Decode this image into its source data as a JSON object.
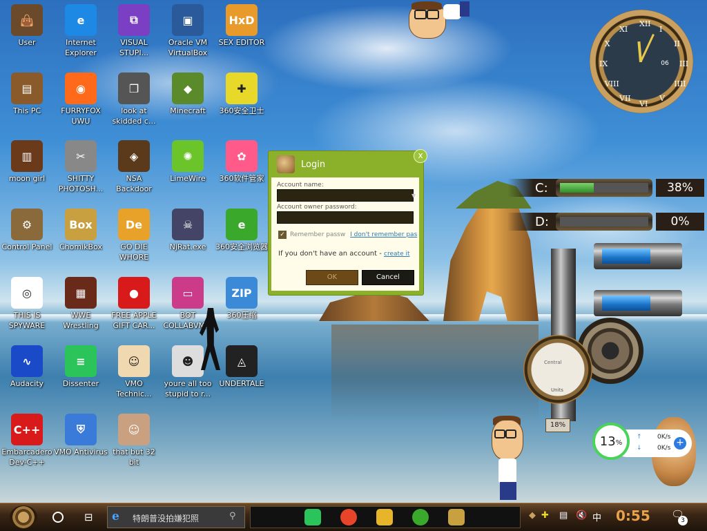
{
  "desktop": {
    "icons": [
      {
        "label": "User",
        "color": "#6a4a2a",
        "glyph": "👜"
      },
      {
        "label": "Internet Explorer",
        "color": "#1e88e5",
        "glyph": "e"
      },
      {
        "label": "VISUAL STUPI...",
        "color": "#7b3fc4",
        "glyph": "⧉"
      },
      {
        "label": "Oracle VM VirtualBox",
        "color": "#2a5a9a",
        "glyph": "▣"
      },
      {
        "label": "SEX EDITOR",
        "color": "#e89a2a",
        "glyph": "HxD"
      },
      {
        "label": "This PC",
        "color": "#8a5a2a",
        "glyph": "▤"
      },
      {
        "label": "FURRYFOX UWU",
        "color": "#ff6a1a",
        "glyph": "◉"
      },
      {
        "label": "look at skidded c...",
        "color": "#555555",
        "glyph": "❐"
      },
      {
        "label": "Minecraft",
        "color": "#5a8a2a",
        "glyph": "◆"
      },
      {
        "label": "360安全卫士",
        "color": "#e8d82a",
        "glyph": "✚"
      },
      {
        "label": "moon girl",
        "color": "#6a3a1a",
        "glyph": "▥"
      },
      {
        "label": "SHITTY PHOTOSH...",
        "color": "#888888",
        "glyph": "✂"
      },
      {
        "label": "NSA Backdoor",
        "color": "#5a3a1a",
        "glyph": "◈"
      },
      {
        "label": "LimeWire",
        "color": "#6ac42a",
        "glyph": "✺"
      },
      {
        "label": "360软件管家",
        "color": "#ff5a8a",
        "glyph": "✿"
      },
      {
        "label": "Control Panel",
        "color": "#8a6a3a",
        "glyph": "⚙"
      },
      {
        "label": "ChomikBox",
        "color": "#c9a040",
        "glyph": "Box"
      },
      {
        "label": "GO DIE WHORE",
        "color": "#e8a22a",
        "glyph": "De"
      },
      {
        "label": "NjRat.exe",
        "color": "#444466",
        "glyph": "☠"
      },
      {
        "label": "360安全浏览器",
        "color": "#3aa82a",
        "glyph": "e"
      },
      {
        "label": "THIS IS SPYWARE",
        "color": "#ffffff",
        "glyph": "◎"
      },
      {
        "label": "WWE Wrestling",
        "color": "#6a2a1a",
        "glyph": "▦"
      },
      {
        "label": "FREE APPLE GIFT CAR...",
        "color": "#d81a1a",
        "glyph": "●"
      },
      {
        "label": "BOT COLLABVM...",
        "color": "#cc3a8a",
        "glyph": "▭"
      },
      {
        "label": "360压缩",
        "color": "#3a8ad8",
        "glyph": "ZIP"
      },
      {
        "label": "Audacity",
        "color": "#1a4ac8",
        "glyph": "∿"
      },
      {
        "label": "Dissenter",
        "color": "#2ac45a",
        "glyph": "≡"
      },
      {
        "label": "VMO Technic...",
        "color": "#f0d8b0",
        "glyph": "☺"
      },
      {
        "label": "youre all too stupid to r...",
        "color": "#dddddd",
        "glyph": "☻"
      },
      {
        "label": "UNDERTALE",
        "color": "#222222",
        "glyph": "◬"
      },
      {
        "label": "Embarcadero Dev-C++",
        "color": "#d81a1a",
        "glyph": "C++"
      },
      {
        "label": "VMO Antivirus",
        "color": "#3a7ad8",
        "glyph": "⛨"
      },
      {
        "label": "that but 32 bit",
        "color": "#c9a080",
        "glyph": "☺"
      }
    ]
  },
  "login": {
    "title": "Login",
    "close_glyph": "x",
    "account_name_label": "Account name:",
    "account_name_value": "",
    "password_label": "Account owner password:",
    "password_value": "",
    "remember_label": "Remember passw",
    "remember_checked": true,
    "forgot_link": "I don't remember pas",
    "no_account_text": "If you don't have an account -",
    "create_link": "create it",
    "ok_label": "OK",
    "cancel_label": "Cancel"
  },
  "clock": {
    "numerals": [
      "XII",
      "I",
      "II",
      "III",
      "IIII",
      "V",
      "VI",
      "VII",
      "VIII",
      "IX",
      "X",
      "XI"
    ],
    "date": "06"
  },
  "drives": [
    {
      "letter": "C:",
      "percent_text": "38%",
      "fill_fraction": 0.38
    },
    {
      "letter": "D:",
      "percent_text": "0%",
      "fill_fraction": 0.0
    }
  ],
  "gauge": {
    "label_top": "Central",
    "label_bottom": "Units",
    "readout": "18%"
  },
  "network": {
    "usage_value": "13",
    "usage_unit": "%",
    "upload": "0K/s",
    "download": "0K/s",
    "up_arrow": "↑",
    "down_arrow": "↓",
    "plus": "+"
  },
  "taskbar": {
    "search_text": "特朗普没拍嫌犯照",
    "search_icon": "magnifier-icon",
    "pinned": [
      {
        "name": "dissenter",
        "color": "#2ac45a"
      },
      {
        "name": "chrome",
        "color": "#e8442a"
      },
      {
        "name": "file-explorer",
        "color": "#e8b42a"
      },
      {
        "name": "360-browser",
        "color": "#3aa82a"
      },
      {
        "name": "chomikbox",
        "color": "#c9a040"
      }
    ],
    "tray": {
      "ime": "中",
      "time": "0:55",
      "notification_count": "3"
    }
  },
  "colors": {
    "login_green": "#8bb02a",
    "clock_time": "#e8a24a",
    "gauge_fill": "#2f8d2a"
  }
}
